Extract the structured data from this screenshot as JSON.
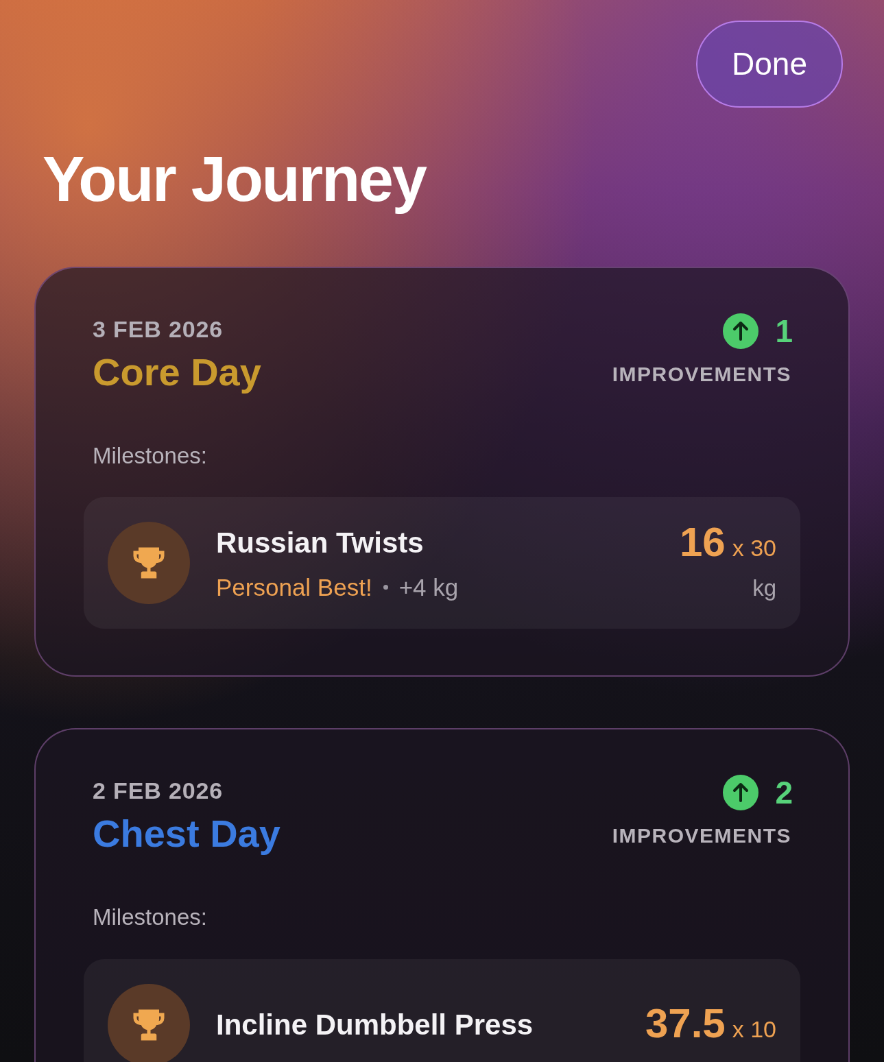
{
  "done_button": "Done",
  "title": "Your Journey",
  "workouts": [
    {
      "date": "3 FEB 2026",
      "name": "Core Day",
      "color": "#c99a2e",
      "improvements": "1",
      "improvements_label": "IMPROVEMENTS",
      "milestones_label": "Milestones:",
      "milestones": [
        {
          "exercise": "Russian Twists",
          "badge": "Personal Best!",
          "delta": "+4 kg",
          "weight": "16",
          "reps": "x 30",
          "unit": "kg"
        }
      ]
    },
    {
      "date": "2 FEB 2026",
      "name": "Chest Day",
      "color": "#3b7be0",
      "improvements": "2",
      "improvements_label": "IMPROVEMENTS",
      "milestones_label": "Milestones:",
      "milestones": [
        {
          "exercise": "Incline Dumbbell Press",
          "weight": "37.5",
          "reps": "x 10"
        }
      ]
    }
  ]
}
